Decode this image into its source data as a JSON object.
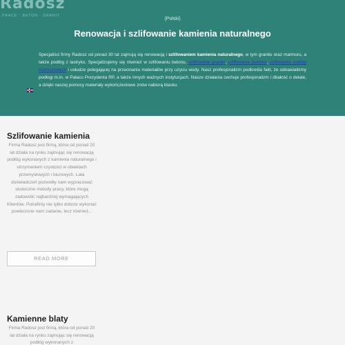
{
  "header": {
    "logo_text": "Radosz",
    "logo_sub": "PRACE · BETON · GRANIT",
    "language": "(Polski)",
    "title": "Renowacja i szlifowanie kamienia naturalnego"
  },
  "intro": {
    "p1": "Specjaliści firmy Radosz od ponad 30 lat zajmują się renowacją i ",
    "p1_bold": "szlifowaniem kamienia naturalnego",
    "p2": ", w tym granitu oraz marmuru, a także podłóg z lastryko. Specjalizujemy się również w szlifowaniu betonu, ",
    "link1": "szlifowanie granitu",
    "sep1": ", ",
    "link2": "szlifowanie lastryko",
    "sep2": ", ",
    "link3": "szlifowanie podłóg marmurowych",
    "p3": " i usłudze polegającej na przecinaniu materiałów przy użyciu wody. Nasz profesjonalizm podkreśla fakt, że odnawialiśmy podłogi m.in. w Pałacu Prezydenta RP, a także innych ważnych instytucjach. Nasze działania cechuje profesjonalizm i dbałość o detale, a dzięki naszej pomocy materiały wykończeniowe znów nabiorą blasku.",
    "flag_icon": "uk-flag-icon"
  },
  "cards": [
    {
      "title": "Szlifowanie kamienia",
      "body": "Firma Radosz jest firmą, która od ponad 20 lat działa na rynku zajmując się renowacją podłóg wykonanych z kamienia naturalnego i utrzymaniem czystości w obiektach przemysłowych i biurowych. Lata doświadczeń pozwoliły nam wypracować skuteczne metody pracy, które mogą zadowolić najbardziej wymagających Klientów. Potrafimy nie tylko dobrze wykonać powierzone nam zadanie, lecz również...",
      "button": "READ MORE"
    },
    {
      "title": "Kamienne blaty",
      "body": "Firma Radosz jest firmą, która od ponad 20 lat działa na rynku zajmując się renowacją podłóg wykonanych z"
    }
  ],
  "colors": {
    "header_bg": "#2e8278",
    "page_bg": "#f4f4f4",
    "link": "#2a39c2"
  }
}
